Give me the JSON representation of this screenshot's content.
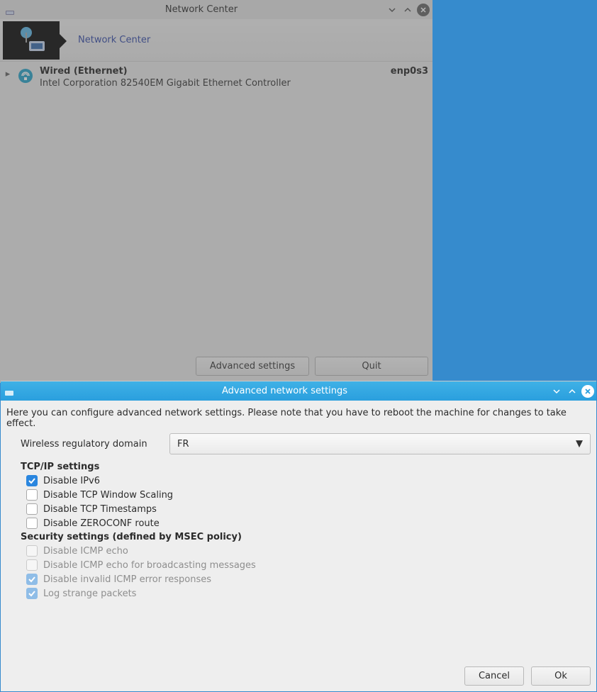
{
  "network_center": {
    "window_title": "Network Center",
    "banner_link": "Network Center",
    "interface": {
      "name": "Wired (Ethernet)",
      "desc": "Intel Corporation 82540EM Gigabit Ethernet Controller",
      "ifname": "enp0s3"
    },
    "buttons": {
      "advanced": "Advanced settings",
      "quit": "Quit"
    }
  },
  "advanced_dialog": {
    "window_title": "Advanced network settings",
    "intro": "Here you can configure advanced network settings. Please note that you have to reboot the machine for changes to take effect.",
    "wireless_domain_label": "Wireless regulatory domain",
    "wireless_domain_value": "FR",
    "tcpip_head": "TCP/IP settings",
    "tcpip_opts": [
      {
        "label": "Disable IPv6",
        "checked": true
      },
      {
        "label": "Disable TCP Window Scaling",
        "checked": false
      },
      {
        "label": "Disable TCP Timestamps",
        "checked": false
      },
      {
        "label": "Disable ZEROCONF route",
        "checked": false
      }
    ],
    "security_head": "Security settings (defined by MSEC policy)",
    "security_opts": [
      {
        "label": "Disable ICMP echo",
        "checked": false
      },
      {
        "label": "Disable ICMP echo for broadcasting messages",
        "checked": false
      },
      {
        "label": "Disable invalid ICMP error responses",
        "checked": true
      },
      {
        "label": "Log strange packets",
        "checked": true
      }
    ],
    "buttons": {
      "cancel": "Cancel",
      "ok": "Ok"
    }
  }
}
